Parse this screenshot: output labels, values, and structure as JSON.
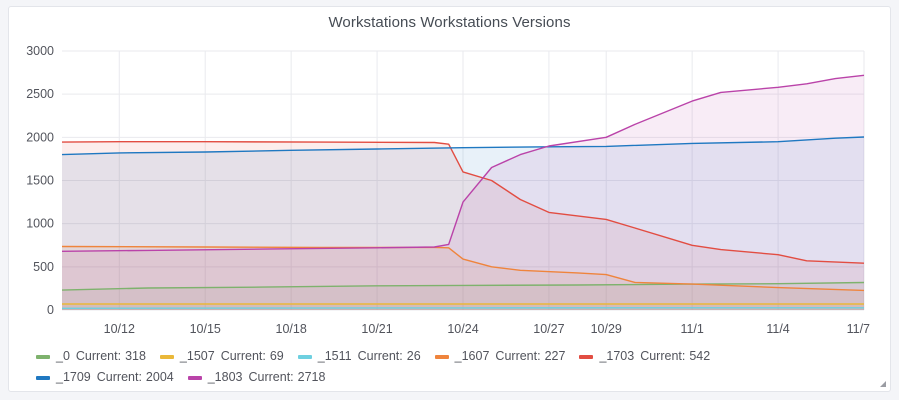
{
  "panel": {
    "title": "Workstations Workstations Versions",
    "current_prefix": "Current:"
  },
  "colors": {
    "grid": "#e9eaee",
    "tick_text": "#52545c"
  },
  "chart_data": {
    "type": "area",
    "title": "Workstations Workstations Versions",
    "xlabel": "",
    "ylabel": "",
    "ylim": [
      0,
      3000
    ],
    "yticks": [
      0,
      500,
      1000,
      1500,
      2000,
      2500,
      3000
    ],
    "xlim": [
      "2017-10-10",
      "2017-11-07"
    ],
    "xticks": [
      {
        "date": "2017-10-12",
        "label": "10/12"
      },
      {
        "date": "2017-10-15",
        "label": "10/15"
      },
      {
        "date": "2017-10-18",
        "label": "10/18"
      },
      {
        "date": "2017-10-21",
        "label": "10/21"
      },
      {
        "date": "2017-10-24",
        "label": "10/24"
      },
      {
        "date": "2017-10-27",
        "label": "10/27"
      },
      {
        "date": "2017-10-29",
        "label": "10/29"
      },
      {
        "date": "2017-11-01",
        "label": "11/1"
      },
      {
        "date": "2017-11-04",
        "label": "11/4"
      },
      {
        "date": "2017-11-07",
        "label": "11/7"
      }
    ],
    "grid": true,
    "legend_position": "bottom",
    "series": [
      {
        "name": "_0",
        "current": 318,
        "color": "#7eb26d",
        "x": [
          "2017-10-10",
          "2017-10-13",
          "2017-10-17",
          "2017-10-21",
          "2017-10-24",
          "2017-10-28",
          "2017-11-01",
          "2017-11-04",
          "2017-11-07"
        ],
        "y": [
          230,
          255,
          265,
          280,
          285,
          290,
          300,
          305,
          318
        ]
      },
      {
        "name": "_1507",
        "current": 69,
        "color": "#eab839",
        "x": [
          "2017-10-10",
          "2017-10-17",
          "2017-10-24",
          "2017-11-01",
          "2017-11-07"
        ],
        "y": [
          70,
          70,
          70,
          69,
          69
        ]
      },
      {
        "name": "_1511",
        "current": 26,
        "color": "#6ed0e0",
        "x": [
          "2017-10-10",
          "2017-10-17",
          "2017-10-24",
          "2017-11-01",
          "2017-11-07"
        ],
        "y": [
          20,
          22,
          24,
          25,
          26
        ]
      },
      {
        "name": "_1607",
        "current": 227,
        "color": "#ef843c",
        "x": [
          "2017-10-10",
          "2017-10-15",
          "2017-10-19",
          "2017-10-23",
          "2017-10-23.5",
          "2017-10-24",
          "2017-10-25",
          "2017-10-26",
          "2017-10-28",
          "2017-10-29",
          "2017-10-30",
          "2017-11-01",
          "2017-11-04",
          "2017-11-07"
        ],
        "y": [
          735,
          730,
          725,
          725,
          720,
          590,
          500,
          460,
          430,
          410,
          320,
          300,
          260,
          227
        ]
      },
      {
        "name": "_1703",
        "current": 542,
        "color": "#e24d42",
        "x": [
          "2017-10-10",
          "2017-10-12",
          "2017-10-15",
          "2017-10-19",
          "2017-10-23",
          "2017-10-23.5",
          "2017-10-24",
          "2017-10-25",
          "2017-10-26",
          "2017-10-27",
          "2017-10-29",
          "2017-10-30",
          "2017-11-01",
          "2017-11-02",
          "2017-11-04",
          "2017-11-05",
          "2017-11-07"
        ],
        "y": [
          1945,
          1950,
          1950,
          1945,
          1940,
          1920,
          1600,
          1500,
          1280,
          1130,
          1050,
          950,
          750,
          700,
          640,
          570,
          542
        ]
      },
      {
        "name": "_1709",
        "current": 2004,
        "color": "#1f78c1",
        "x": [
          "2017-10-10",
          "2017-10-12",
          "2017-10-15",
          "2017-10-18",
          "2017-10-21",
          "2017-10-24",
          "2017-10-27",
          "2017-10-29",
          "2017-11-01",
          "2017-11-04",
          "2017-11-06",
          "2017-11-07"
        ],
        "y": [
          1800,
          1820,
          1830,
          1850,
          1865,
          1880,
          1890,
          1895,
          1930,
          1950,
          1990,
          2004
        ]
      },
      {
        "name": "_1803",
        "current": 2718,
        "color": "#ba43a9",
        "x": [
          "2017-10-10",
          "2017-10-13",
          "2017-10-17",
          "2017-10-21",
          "2017-10-23",
          "2017-10-23.5",
          "2017-10-24",
          "2017-10-25",
          "2017-10-26",
          "2017-10-27",
          "2017-10-29",
          "2017-10-30",
          "2017-11-01",
          "2017-11-02",
          "2017-11-04",
          "2017-11-05",
          "2017-11-06",
          "2017-11-07"
        ],
        "y": [
          680,
          690,
          705,
          720,
          730,
          760,
          1250,
          1650,
          1800,
          1900,
          2000,
          2150,
          2420,
          2520,
          2580,
          2620,
          2680,
          2718
        ]
      }
    ]
  }
}
